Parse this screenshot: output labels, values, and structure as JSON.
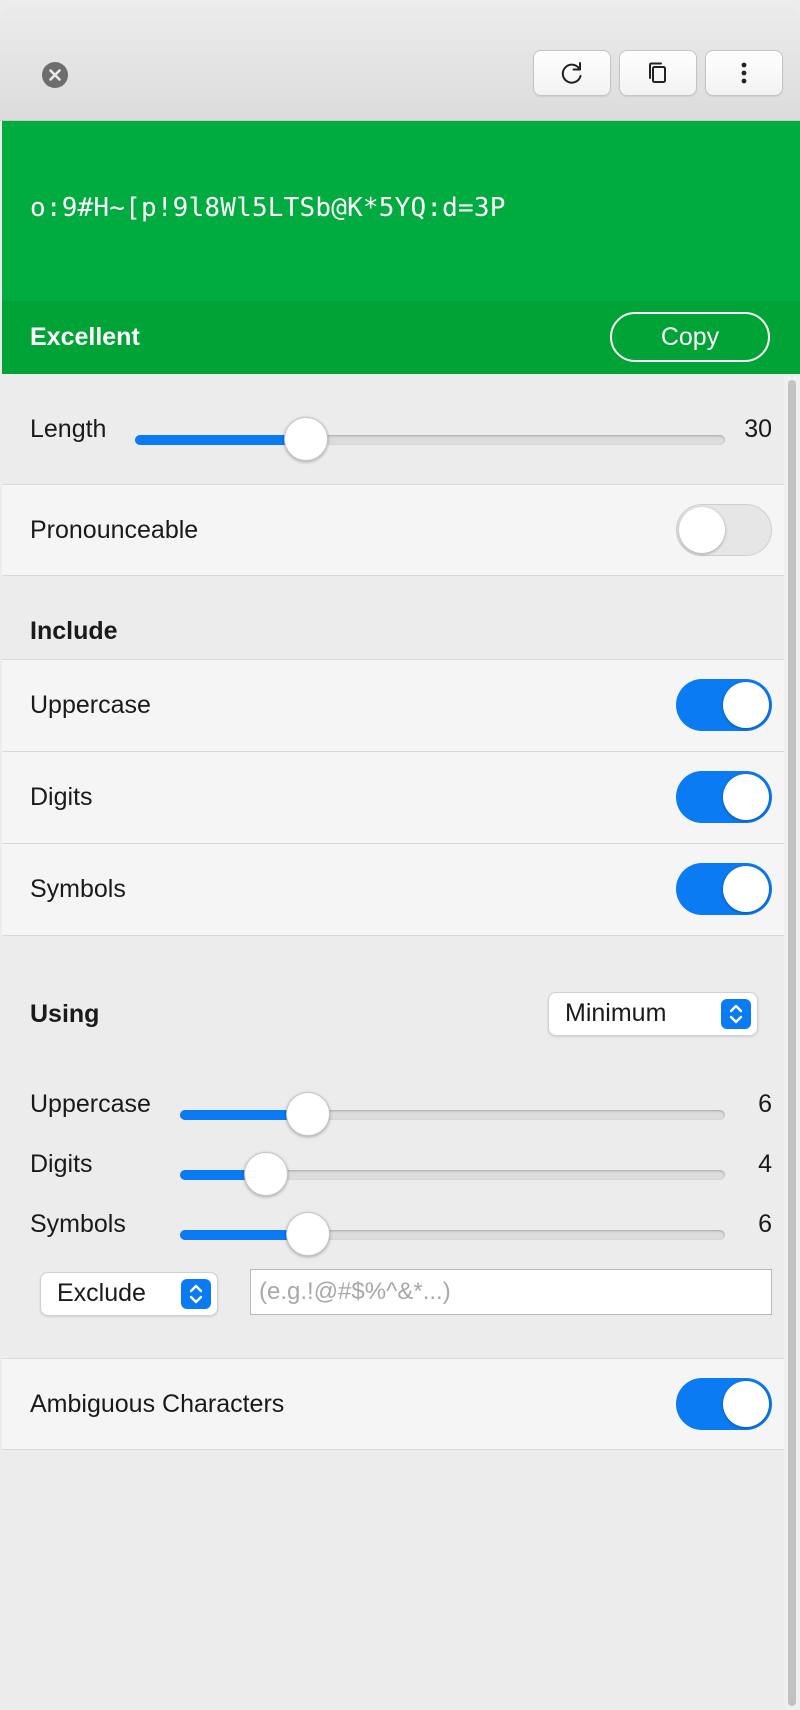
{
  "toolbar": {
    "close_icon": "close-circle-icon",
    "buttons": [
      {
        "icon": "refresh-icon"
      },
      {
        "icon": "copy-icon"
      },
      {
        "icon": "more-vertical-icon"
      }
    ]
  },
  "password": {
    "value": "o:9#H~[p!9l8Wl5LTSb@K*5YQ:d=3P",
    "strength": "Excellent",
    "copy_label": "Copy",
    "colors": {
      "panel": "#00ab3f",
      "strength_bar": "#00a335"
    }
  },
  "length": {
    "label": "Length",
    "value": 30,
    "fraction": 0.29
  },
  "pronounceable": {
    "label": "Pronounceable",
    "on": false
  },
  "include": {
    "title": "Include",
    "items": [
      {
        "label": "Uppercase",
        "on": true
      },
      {
        "label": "Digits",
        "on": true
      },
      {
        "label": "Symbols",
        "on": true
      }
    ]
  },
  "using": {
    "title": "Using",
    "mode": "Minimum",
    "sliders": [
      {
        "label": "Uppercase",
        "value": 6,
        "fraction": 0.235
      },
      {
        "label": "Digits",
        "value": 4,
        "fraction": 0.157
      },
      {
        "label": "Symbols",
        "value": 6,
        "fraction": 0.235
      }
    ],
    "exclude_mode": "Exclude",
    "exclude_placeholder": "(e.g.!@#$%^&*...)",
    "exclude_value": ""
  },
  "ambiguous": {
    "label": "Ambiguous Characters",
    "on": true
  },
  "accent_color": "#0a7bf2"
}
